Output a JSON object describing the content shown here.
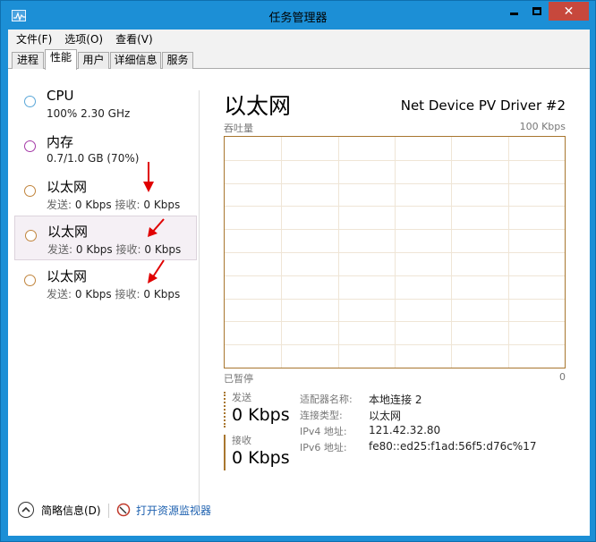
{
  "window": {
    "title": "任务管理器"
  },
  "menu": {
    "items": [
      "文件(F)",
      "选项(O)",
      "查看(V)"
    ]
  },
  "tabs": [
    {
      "label": "进程",
      "active": false
    },
    {
      "label": "性能",
      "active": true
    },
    {
      "label": "用户",
      "active": false
    },
    {
      "label": "详细信息",
      "active": false
    },
    {
      "label": "服务",
      "active": false
    }
  ],
  "resources": [
    {
      "name": "CPU",
      "detail": "100% 2.30 GHz",
      "color": "#5aa7d8"
    },
    {
      "name": "内存",
      "detail": "0.7/1.0 GB (70%)",
      "color": "#a53aa8"
    },
    {
      "name": "以太网",
      "send_label": "发送:",
      "send_value": "0 Kbps",
      "recv_label": "接收:",
      "recv_value": "0 Kbps",
      "color": "#c0843c"
    },
    {
      "name": "以太网",
      "send_label": "发送:",
      "send_value": "0 Kbps",
      "recv_label": "接收:",
      "recv_value": "0 Kbps",
      "color": "#c0843c",
      "selected": true
    },
    {
      "name": "以太网",
      "send_label": "发送:",
      "send_value": "0 Kbps",
      "recv_label": "接收:",
      "recv_value": "0 Kbps",
      "color": "#c0843c"
    }
  ],
  "detail": {
    "title": "以太网",
    "device": "Net Device PV Driver #2",
    "graph_label": "吞吐量",
    "graph_max": "100 Kbps",
    "paused_label": "已暂停",
    "graph_min": "0",
    "send_label": "发送",
    "send_value": "0 Kbps",
    "recv_label": "接收",
    "recv_value": "0 Kbps",
    "properties": [
      {
        "key": "适配器名称:",
        "value": "本地连接 2"
      },
      {
        "key": "连接类型:",
        "value": "以太网"
      },
      {
        "key": "IPv4 地址:",
        "value": "121.42.32.80"
      },
      {
        "key": "IPv6 地址:",
        "value": "fe80::ed25:f1ad:56f5:d76c%17"
      }
    ]
  },
  "footer": {
    "fold_label": "简略信息(D)",
    "monitor_link": "打开资源监视器"
  },
  "colors": {
    "accent": "#1c8fd6",
    "graph_border": "#a8762e",
    "close_button": "#c7483c",
    "annotation_arrow": "#e00000"
  }
}
